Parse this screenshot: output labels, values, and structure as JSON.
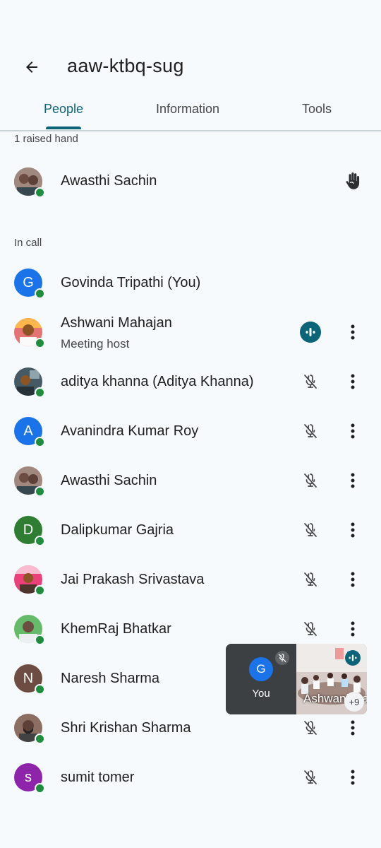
{
  "meeting": {
    "title": "aaw-ktbq-sug"
  },
  "tabs": [
    {
      "label": "People",
      "active": true
    },
    {
      "label": "Information",
      "active": false
    },
    {
      "label": "Tools",
      "active": false
    }
  ],
  "raised_section": {
    "label": "1 raised hand",
    "people": [
      {
        "name": "Awasthi Sachin",
        "icon": "raised-hand-icon"
      }
    ]
  },
  "in_call_section": {
    "label": "In call",
    "people": [
      {
        "name": "Govinda Tripathi (You)",
        "initial": "G",
        "avatar_color": "#1a73e8"
      },
      {
        "name": "Ashwani Mahajan",
        "subtitle": "Meeting host",
        "mic": "speaking"
      },
      {
        "name": "aditya khanna (Aditya Khanna)",
        "mic": "muted"
      },
      {
        "name": "Avanindra Kumar Roy",
        "initial": "A",
        "avatar_color": "#1a73e8",
        "mic": "muted"
      },
      {
        "name": "Awasthi Sachin",
        "mic": "muted"
      },
      {
        "name": "Dalipkumar Gajria",
        "initial": "D",
        "avatar_color": "#2e7d32",
        "mic": "muted"
      },
      {
        "name": "Jai Prakash Srivastava",
        "mic": "muted"
      },
      {
        "name": "KhemRaj Bhatkar",
        "mic": "muted"
      },
      {
        "name": "Naresh Sharma",
        "initial": "N",
        "avatar_color": "#6d4c41"
      },
      {
        "name": "Shri Krishan Sharma",
        "mic": "muted"
      },
      {
        "name": "sumit tomer",
        "initial": "s",
        "avatar_color": "#8e24aa",
        "mic": "muted"
      }
    ]
  },
  "pip": {
    "you_initial": "G",
    "you_label": "You",
    "other_name": "Ashwani Mahajan",
    "other_count": "+9"
  },
  "colors": {
    "accent": "#0b6477",
    "online": "#1e8e3e"
  }
}
